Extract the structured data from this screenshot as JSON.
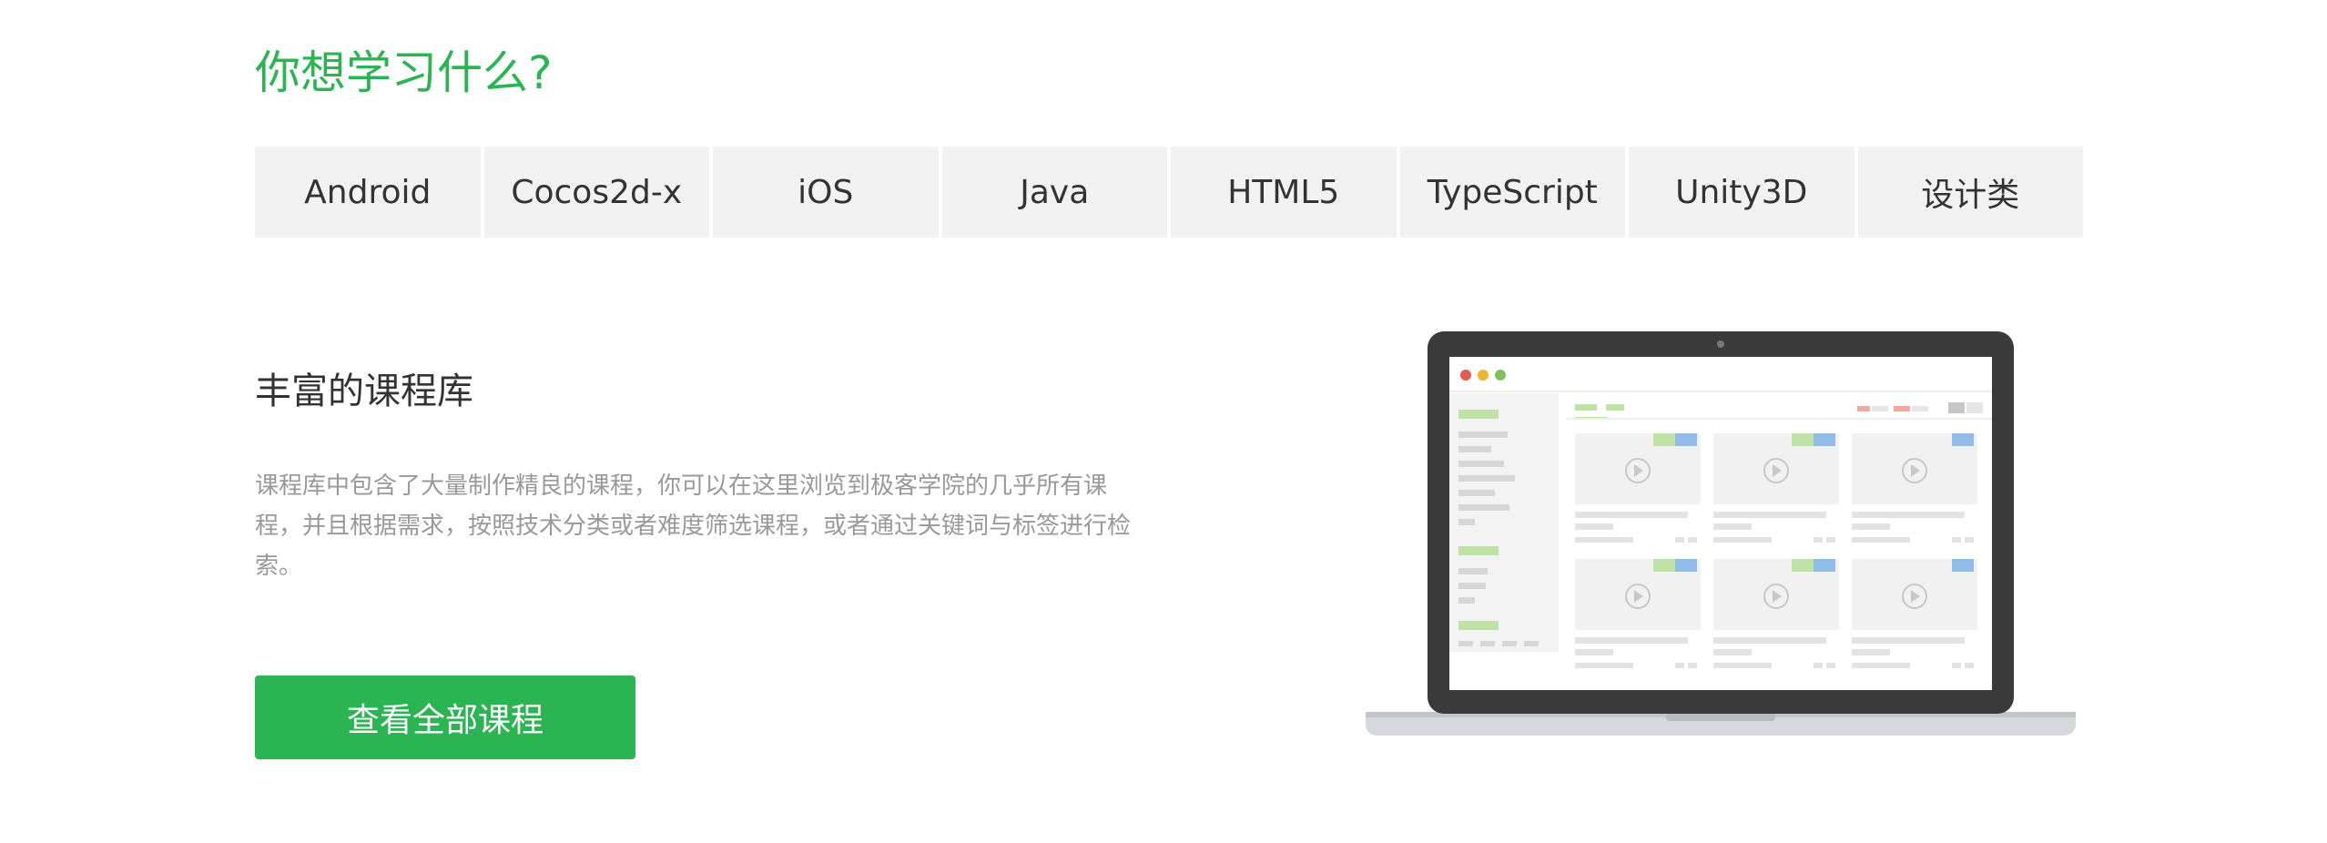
{
  "heading": "你想学习什么?",
  "tabs": [
    {
      "label": "Android"
    },
    {
      "label": "Cocos2d-x"
    },
    {
      "label": "iOS"
    },
    {
      "label": "Java"
    },
    {
      "label": "HTML5"
    },
    {
      "label": "TypeScript"
    },
    {
      "label": "Unity3D"
    },
    {
      "label": "设计类"
    }
  ],
  "feature": {
    "title": "丰富的课程库",
    "description": "课程库中包含了大量制作精良的课程，你可以在这里浏览到极客学院的几乎所有课程，并且根据需求，按照技术分类或者难度筛选课程，或者通过关键词与标签进行检索。",
    "button_label": "查看全部课程"
  },
  "colors": {
    "accent": "#2bb552",
    "tab_bg": "#f2f2f2",
    "text_dark": "#333333",
    "text_muted": "#999999"
  },
  "illustration": {
    "icon": "laptop-course-library-illustration"
  }
}
